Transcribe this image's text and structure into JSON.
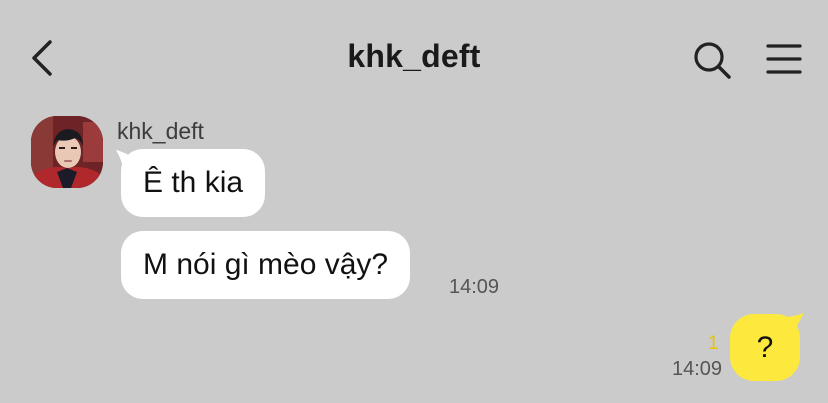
{
  "header": {
    "title": "khk_deft",
    "back_icon": "chevron-left-icon",
    "search_icon": "search-icon",
    "menu_icon": "hamburger-menu-icon"
  },
  "chat": {
    "sender_name": "khk_deft",
    "incoming_messages": [
      {
        "text": "Ê th kia"
      },
      {
        "text": "M nói gì mèo vậy?",
        "time": "14:09"
      }
    ],
    "outgoing_message": {
      "text": "?",
      "time": "14:09",
      "unread_count": "1"
    }
  },
  "colors": {
    "background": "#cbcbcb",
    "incoming_bubble": "#ffffff",
    "outgoing_bubble": "#fde93d",
    "unread_count": "#e6c400"
  }
}
